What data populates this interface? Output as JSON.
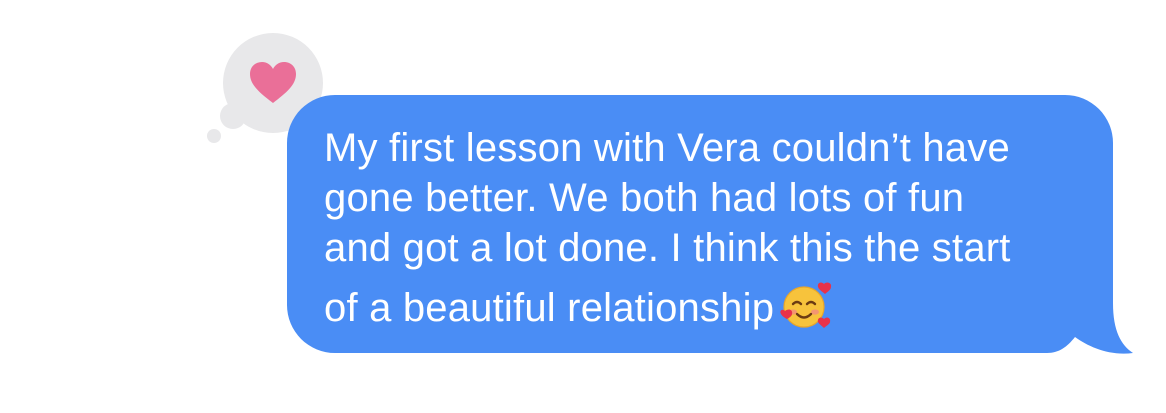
{
  "message": {
    "lines": [
      "My first lesson with Vera couldn’t have",
      "gone better. We both had lots of fun",
      "and got a lot done. I think this the start",
      "of a beautiful relationship"
    ],
    "emoji": "smiling-face-with-hearts"
  },
  "tapback": {
    "icon": "heart-icon"
  },
  "colors": {
    "bubble": "#4a8df5",
    "text": "#ffffff",
    "tapback_bg": "#e8e8ea",
    "heart": "#ea6f98",
    "background": "#ffffff"
  }
}
